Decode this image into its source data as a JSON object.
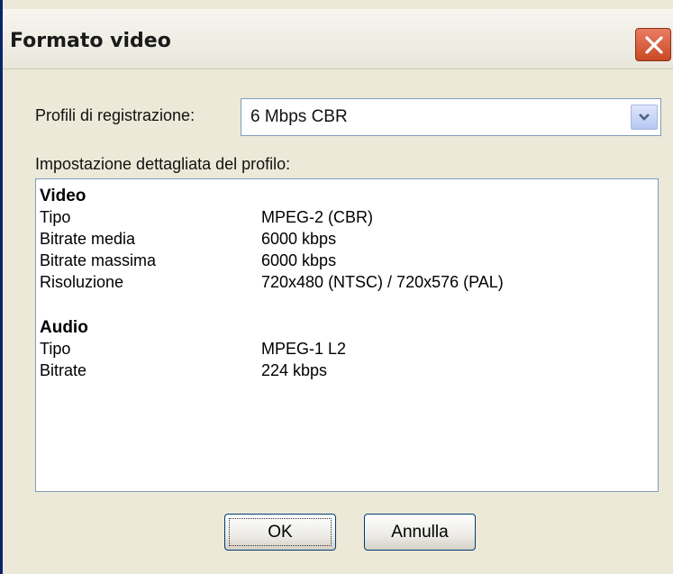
{
  "window": {
    "title": "Formato video"
  },
  "profiles": {
    "label": "Profili di registrazione:",
    "selected": "6 Mbps CBR"
  },
  "details": {
    "label": "Impostazione dettagliata del profilo:",
    "video": {
      "heading": "Video",
      "rows": [
        {
          "key": "Tipo",
          "value": "MPEG-2 (CBR)"
        },
        {
          "key": "Bitrate media",
          "value": "6000 kbps"
        },
        {
          "key": "Bitrate massima",
          "value": "6000 kbps"
        },
        {
          "key": "Risoluzione",
          "value": "720x480 (NTSC) / 720x576 (PAL)"
        }
      ]
    },
    "audio": {
      "heading": "Audio",
      "rows": [
        {
          "key": "Tipo",
          "value": "MPEG-1 L2"
        },
        {
          "key": "Bitrate",
          "value": "224 kbps"
        }
      ]
    }
  },
  "buttons": {
    "ok": "OK",
    "cancel": "Annulla"
  }
}
